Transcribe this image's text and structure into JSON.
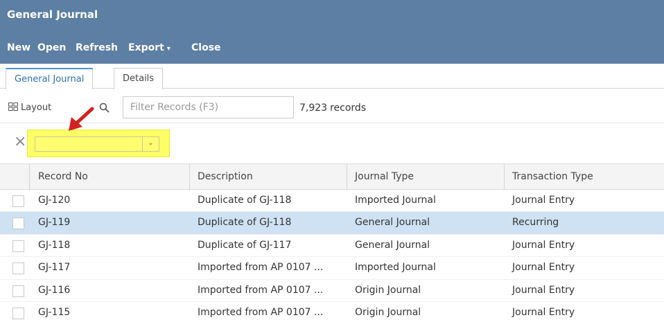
{
  "window": {
    "title": "General Journal"
  },
  "toolbar": {
    "new_label": "New",
    "open_label": "Open",
    "refresh_label": "Refresh",
    "export_label": "Export",
    "export_caret": "▾",
    "close_label": "Close"
  },
  "tabs": [
    {
      "label": "General Journal",
      "active": true
    },
    {
      "label": "Details",
      "active": false
    }
  ],
  "searchbar": {
    "layout_label": "Layout",
    "filter_placeholder": "Filter Records (F3)",
    "record_count": "7,923",
    "record_count_label": "records"
  },
  "filter": {
    "clear_glyph": "×",
    "combo_value": "",
    "combo_arrow": "⌄",
    "highlight_color": "#ffff66",
    "arrow_color": "#d42020"
  },
  "grid": {
    "columns": [
      "Record No",
      "Description",
      "Journal Type",
      "Transaction Type"
    ],
    "rows": [
      {
        "record_no": "GJ-120",
        "description": "Duplicate of GJ-118",
        "journal_type": "Imported Journal",
        "transaction_type": "Journal Entry",
        "selected": false
      },
      {
        "record_no": "GJ-119",
        "description": "Duplicate of GJ-118",
        "journal_type": "General Journal",
        "transaction_type": "Recurring",
        "selected": true
      },
      {
        "record_no": "GJ-118",
        "description": "Duplicate of GJ-117",
        "journal_type": "General Journal",
        "transaction_type": "Journal Entry",
        "selected": false
      },
      {
        "record_no": "GJ-117",
        "description": "Imported from AP 0107 ...",
        "journal_type": "Imported Journal",
        "transaction_type": "Journal Entry",
        "selected": false
      },
      {
        "record_no": "GJ-116",
        "description": "Imported from AP 0107 ...",
        "journal_type": "Origin Journal",
        "transaction_type": "Journal Entry",
        "selected": false
      },
      {
        "record_no": "GJ-115",
        "description": "Imported from AP 0107 ...",
        "journal_type": "Origin Journal",
        "transaction_type": "Journal Entry",
        "selected": false
      }
    ]
  },
  "colors": {
    "header_bg": "#5c7fa3",
    "selected_row": "#cfe2f3",
    "active_tab_text": "#2f6fb5"
  }
}
